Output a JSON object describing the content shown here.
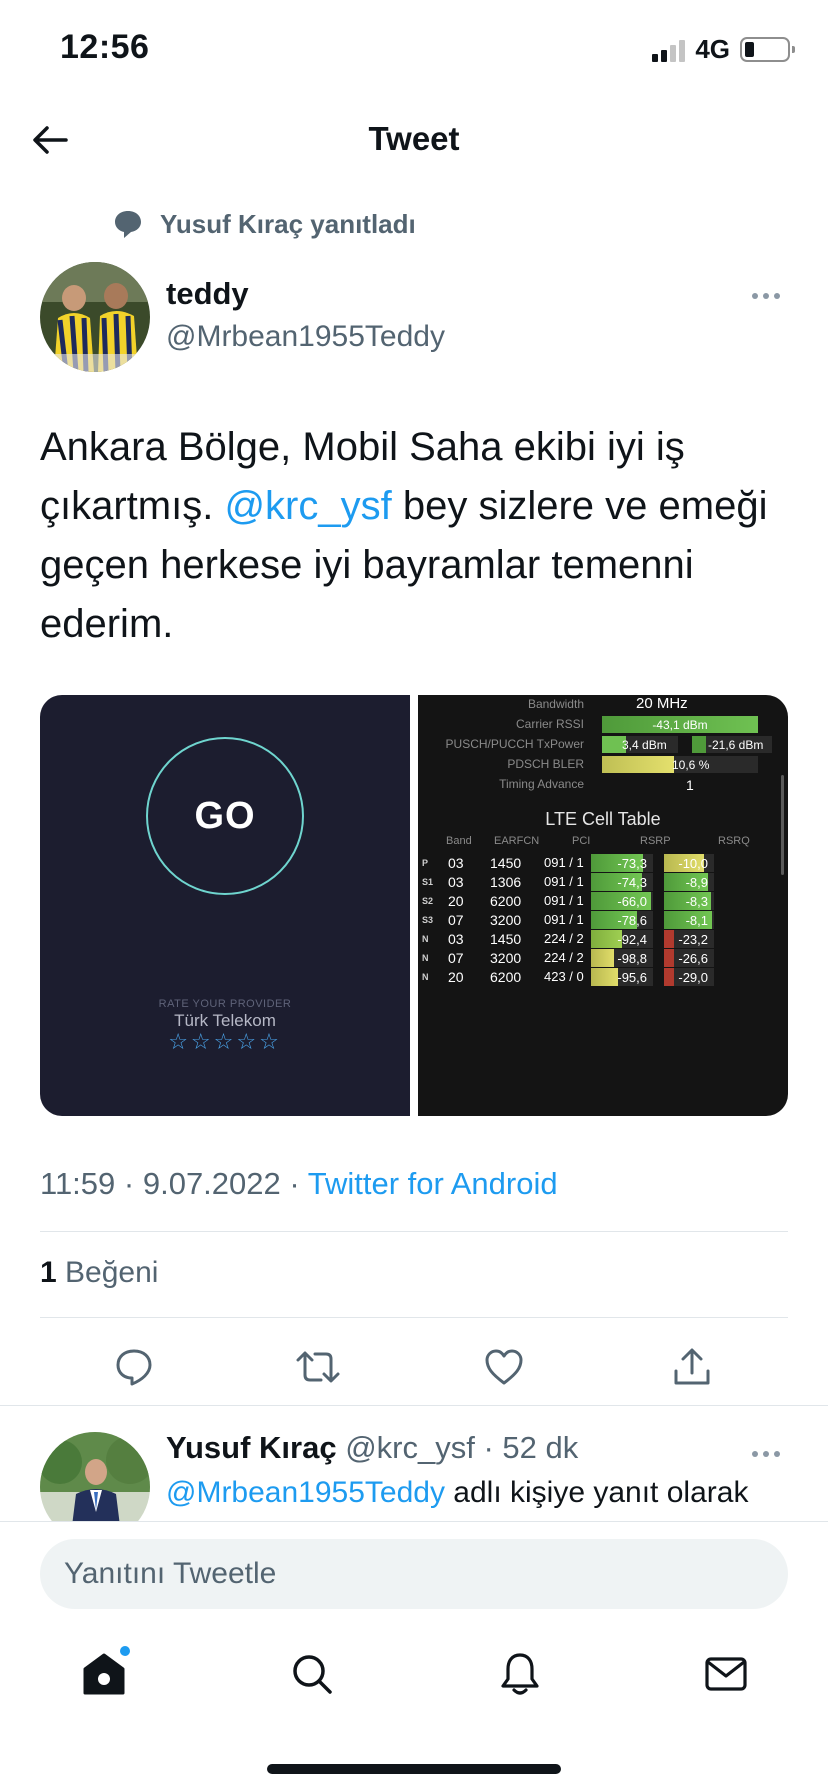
{
  "status_bar": {
    "time": "12:56",
    "network": "4G"
  },
  "header": {
    "title": "Tweet"
  },
  "reply_context": {
    "text": "Yusuf Kıraç yanıtladı"
  },
  "tweet": {
    "author_name": "teddy",
    "author_handle": "@Mrbean1955Teddy",
    "text_part1": "Ankara Bölge, Mobil Saha ekibi iyi iş çıkartmış. ",
    "mention": "@krc_ysf",
    "text_part2": " bey sizlere ve emeği geçen herkese iyi bayramlar temenni ederim.",
    "time": "11:59",
    "date": "9.07.2022",
    "source": "Twitter for Android",
    "likes_count": "1",
    "likes_label": "Beğeni"
  },
  "media_left": {
    "go_label": "GO",
    "rate_label": "RATE YOUR PROVIDER",
    "provider": "Türk Telekom",
    "stars": "☆☆☆☆☆"
  },
  "media_right": {
    "bandwidth_label": "Bandwidth",
    "bandwidth_value": "20 MHz",
    "rssi_label": "Carrier RSSI",
    "rssi_value": "-43,1 dBm",
    "txpower_label": "PUSCH/PUCCH TxPower",
    "txpower_value1": "3,4 dBm",
    "txpower_value2": "-21,6 dBm",
    "bler_label": "PDSCH BLER",
    "bler_value": "10,6 %",
    "ta_label": "Timing Advance",
    "ta_value": "1",
    "table_title": "LTE Cell Table",
    "headers": [
      "Band",
      "EARFCN",
      "PCI",
      "RSRP",
      "RSRQ"
    ],
    "rows": [
      {
        "tag": "P",
        "band": "03",
        "earfcn": "1450",
        "pci": "091 / 1",
        "rsrp": "-73,3",
        "rsrq": "-10,0"
      },
      {
        "tag": "S1",
        "band": "03",
        "earfcn": "1306",
        "pci": "091 / 1",
        "rsrp": "-74,3",
        "rsrq": "-8,9"
      },
      {
        "tag": "S2",
        "band": "20",
        "earfcn": "6200",
        "pci": "091 / 1",
        "rsrp": "-66,0",
        "rsrq": "-8,3"
      },
      {
        "tag": "S3",
        "band": "07",
        "earfcn": "3200",
        "pci": "091 / 1",
        "rsrp": "-78,6",
        "rsrq": "-8,1"
      },
      {
        "tag": "N",
        "band": "03",
        "earfcn": "1450",
        "pci": "224 / 2",
        "rsrp": "-92,4",
        "rsrq": "-23,2"
      },
      {
        "tag": "N",
        "band": "07",
        "earfcn": "3200",
        "pci": "224 / 2",
        "rsrp": "-98,8",
        "rsrq": "-26,6"
      },
      {
        "tag": "N",
        "band": "20",
        "earfcn": "6200",
        "pci": "423 / 0",
        "rsrp": "-95,6",
        "rsrq": "-29,0"
      }
    ]
  },
  "reply_tweet": {
    "author_name": "Yusuf Kıraç",
    "author_handle": "@krc_ysf",
    "age": "52 dk",
    "replying_to_handle": "@Mrbean1955Teddy",
    "replying_to_suffix": " adlı kişiye yanıt olarak"
  },
  "composer": {
    "placeholder": "Yanıtını Tweetle"
  },
  "colors": {
    "accent": "#1d9bf0",
    "muted": "#536471",
    "text": "#0f1419"
  },
  "icons": {
    "back": "arrow-left-icon",
    "reply_context": "speech-bubble-icon",
    "more": "more-dots-icon",
    "reply": "reply-icon",
    "retweet": "retweet-icon",
    "like": "heart-icon",
    "share": "share-icon",
    "home": "home-icon",
    "search": "search-icon",
    "notifications": "bell-icon",
    "messages": "mail-icon"
  }
}
